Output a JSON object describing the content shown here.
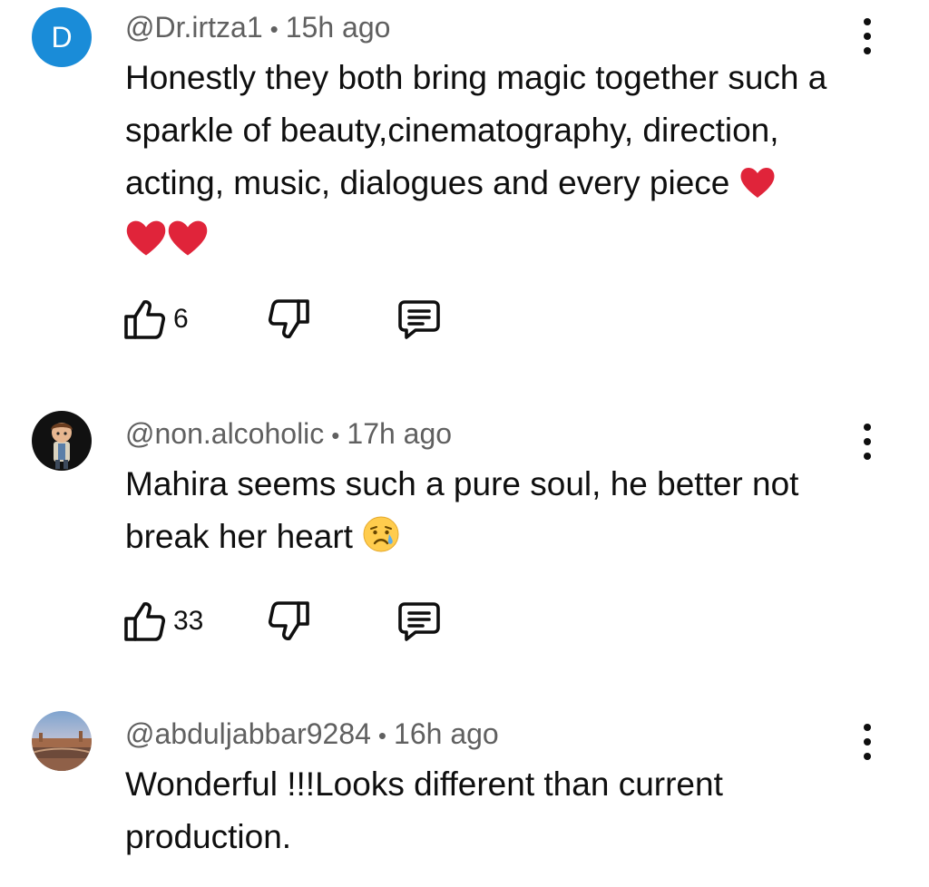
{
  "comments": [
    {
      "avatar_letter": "D",
      "avatar_color": "#1a8cd8",
      "handle": "@Dr.irtza1",
      "separator": "•",
      "time": "15h ago",
      "text": "Honestly they both bring magic together such a sparkle of beauty,cinematography, direction, acting, music, dialogues and every piece",
      "emojis": [
        "red-heart",
        "red-heart",
        "red-heart"
      ],
      "likes": "6"
    },
    {
      "avatar_icon": "cartoon-boy-avatar",
      "handle": "@non.alcoholic",
      "separator": "•",
      "time": "17h ago",
      "text": "Mahira seems such a pure soul, he better not break her heart",
      "emojis": [
        "sad-but-relieved-face"
      ],
      "likes": "33"
    },
    {
      "avatar_icon": "city-photo-avatar",
      "handle": "@abduljabbar9284",
      "separator": "•",
      "time": "16h ago",
      "text": "Wonderful !!!Looks different than current production."
    }
  ],
  "colors": {
    "meta_text": "#606060",
    "body_text": "#0f0f0f",
    "heart": "#e0243a"
  }
}
